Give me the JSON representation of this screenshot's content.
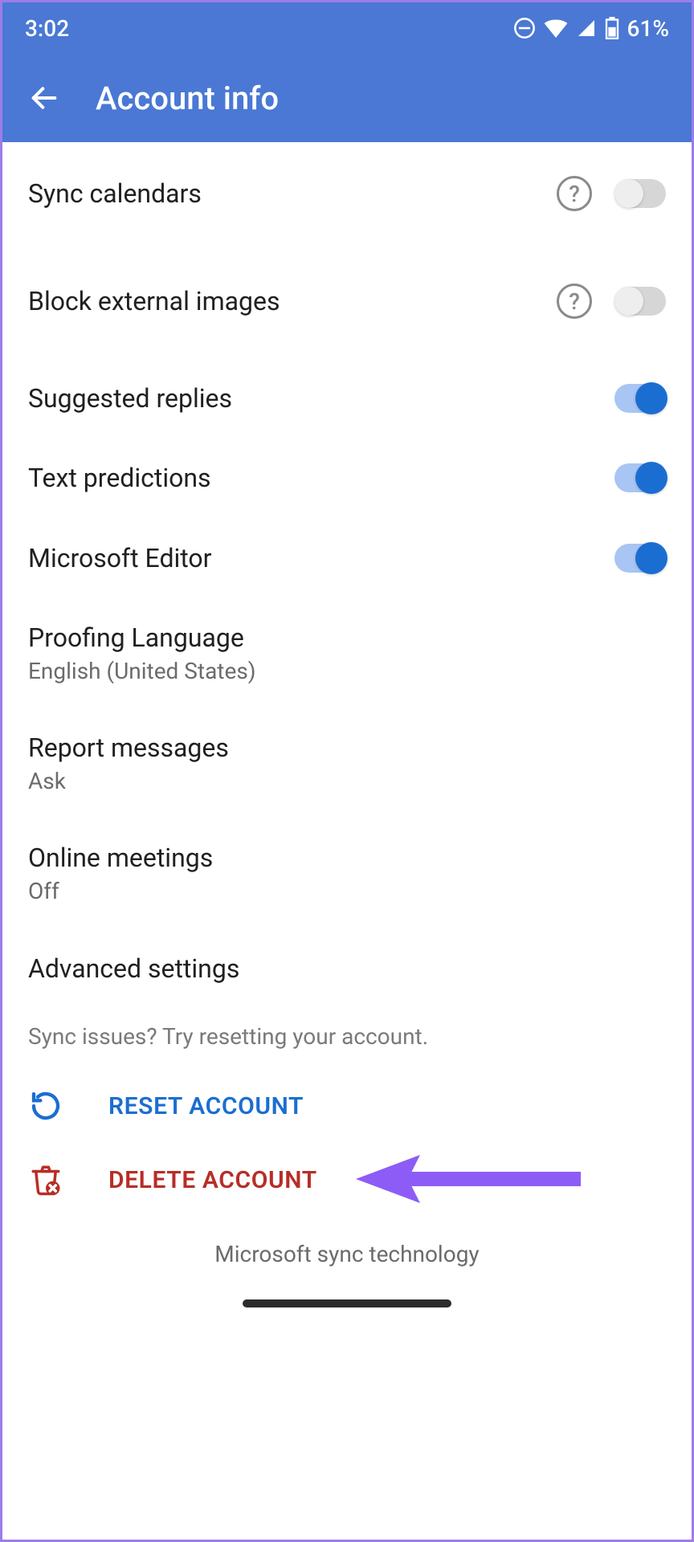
{
  "status": {
    "time": "3:02",
    "battery_pct": "61%"
  },
  "header": {
    "title": "Account info"
  },
  "rows": {
    "sync_calendars": {
      "title": "Sync calendars"
    },
    "block_images": {
      "title": "Block external images"
    },
    "suggested": {
      "title": "Suggested replies"
    },
    "text_pred": {
      "title": "Text predictions"
    },
    "ms_editor": {
      "title": "Microsoft Editor"
    },
    "proofing": {
      "title": "Proofing Language",
      "sub": "English (United States)"
    },
    "report": {
      "title": "Report messages",
      "sub": "Ask"
    },
    "online_mtg": {
      "title": "Online meetings",
      "sub": "Off"
    },
    "advanced": {
      "title": "Advanced settings"
    }
  },
  "hint": "Sync issues? Try resetting your account.",
  "actions": {
    "reset": {
      "label": "RESET ACCOUNT"
    },
    "delete": {
      "label": "DELETE ACCOUNT"
    }
  },
  "footer": "Microsoft sync technology",
  "toggles": {
    "sync_calendars": false,
    "block_images": false,
    "suggested": true,
    "text_pred": true,
    "ms_editor": true
  },
  "colors": {
    "primary": "#4a78d4",
    "accent": "#1b6ed1",
    "danger": "#b82d26",
    "annotation": "#8d5cf6"
  }
}
